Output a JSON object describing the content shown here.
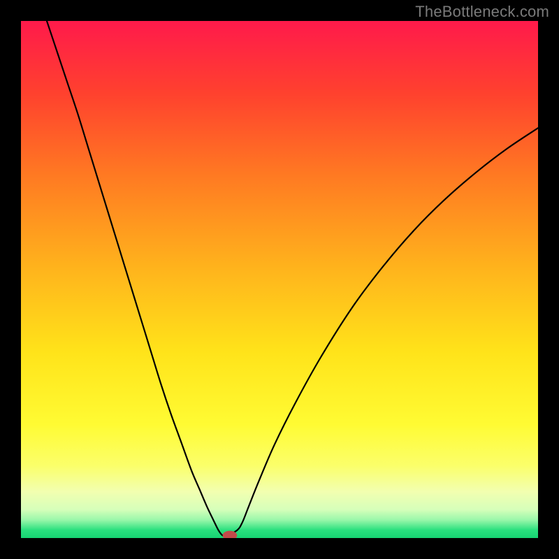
{
  "watermark": "TheBottleneck.com",
  "chart_data": {
    "type": "line",
    "title": "",
    "xlabel": "",
    "ylabel": "",
    "xlim": [
      0,
      100
    ],
    "ylim": [
      0,
      100
    ],
    "grid": false,
    "background_gradient": {
      "stops": [
        {
          "offset": 0.0,
          "color": "#ff1a4b"
        },
        {
          "offset": 0.14,
          "color": "#ff412e"
        },
        {
          "offset": 0.3,
          "color": "#ff7a22"
        },
        {
          "offset": 0.48,
          "color": "#ffb41c"
        },
        {
          "offset": 0.64,
          "color": "#ffe31a"
        },
        {
          "offset": 0.78,
          "color": "#fffb33"
        },
        {
          "offset": 0.86,
          "color": "#fbff6a"
        },
        {
          "offset": 0.91,
          "color": "#f2ffb0"
        },
        {
          "offset": 0.945,
          "color": "#d6ffba"
        },
        {
          "offset": 0.965,
          "color": "#99f7aa"
        },
        {
          "offset": 0.985,
          "color": "#28e07e"
        },
        {
          "offset": 1.0,
          "color": "#17d372"
        }
      ]
    },
    "series": [
      {
        "name": "bottleneck-curve",
        "stroke": "#000000",
        "stroke_width": 2.2,
        "x": [
          5.0,
          7.0,
          9.0,
          11.0,
          13.0,
          15.0,
          17.0,
          19.0,
          21.0,
          23.0,
          25.0,
          27.0,
          29.0,
          31.0,
          33.0,
          34.5,
          36.0,
          37.2,
          38.2,
          39.0,
          39.8,
          41.8,
          42.8,
          44.0,
          46.0,
          49.0,
          53.0,
          58.0,
          64.0,
          70.0,
          76.0,
          82.0,
          88.0,
          94.0,
          100.0
        ],
        "y": [
          100.0,
          94.0,
          88.0,
          82.0,
          75.5,
          69.0,
          62.5,
          56.0,
          49.5,
          43.0,
          36.5,
          30.0,
          24.0,
          18.5,
          13.0,
          9.5,
          6.0,
          3.5,
          1.5,
          0.5,
          0.5,
          1.5,
          3.0,
          6.0,
          11.0,
          18.0,
          26.0,
          35.0,
          44.5,
          52.5,
          59.5,
          65.5,
          70.7,
          75.3,
          79.3
        ]
      }
    ],
    "marker": {
      "name": "optimum-point",
      "x": 40.4,
      "y": 0.5,
      "rx": 1.4,
      "ry": 0.9,
      "fill": "#c24a4a"
    }
  }
}
